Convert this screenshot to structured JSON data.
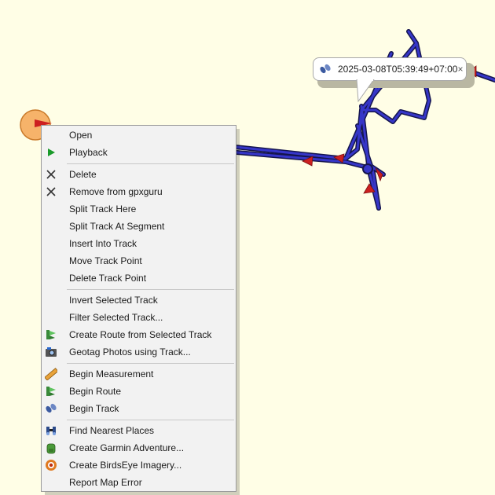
{
  "tooltip": {
    "text": "2025-03-08T05:39:49+07:00",
    "close": "×",
    "icon": "footprints-icon"
  },
  "menu": {
    "items": [
      {
        "label": "Open",
        "icon": ""
      },
      {
        "label": "Playback",
        "icon": "play-icon"
      },
      {
        "label": "Delete",
        "icon": "x-icon"
      },
      {
        "label": "Remove from gpxguru",
        "icon": "x-icon"
      },
      {
        "label": "Split Track Here",
        "icon": ""
      },
      {
        "label": "Split Track At Segment",
        "icon": ""
      },
      {
        "label": "Insert Into Track",
        "icon": ""
      },
      {
        "label": "Move Track Point",
        "icon": ""
      },
      {
        "label": "Delete Track Point",
        "icon": ""
      },
      {
        "label": "Invert Selected Track",
        "icon": ""
      },
      {
        "label": "Filter Selected Track...",
        "icon": ""
      },
      {
        "label": "Create Route from Selected Track",
        "icon": "route-icon"
      },
      {
        "label": "Geotag Photos using Track...",
        "icon": "camera-icon"
      },
      {
        "label": "Begin Measurement",
        "icon": "ruler-icon"
      },
      {
        "label": "Begin Route",
        "icon": "route-icon"
      },
      {
        "label": "Begin Track",
        "icon": "footprints-icon"
      },
      {
        "label": "Find Nearest Places",
        "icon": "binoculars-icon"
      },
      {
        "label": "Create Garmin Adventure...",
        "icon": "backpack-icon"
      },
      {
        "label": "Create BirdsEye Imagery...",
        "icon": "birdseye-icon"
      },
      {
        "label": "Report Map Error",
        "icon": ""
      }
    ]
  },
  "colors": {
    "map_background": "#fffee6",
    "track": "#2b2ba8",
    "arrow": "#cc2020",
    "marker": "#f6b36a"
  }
}
